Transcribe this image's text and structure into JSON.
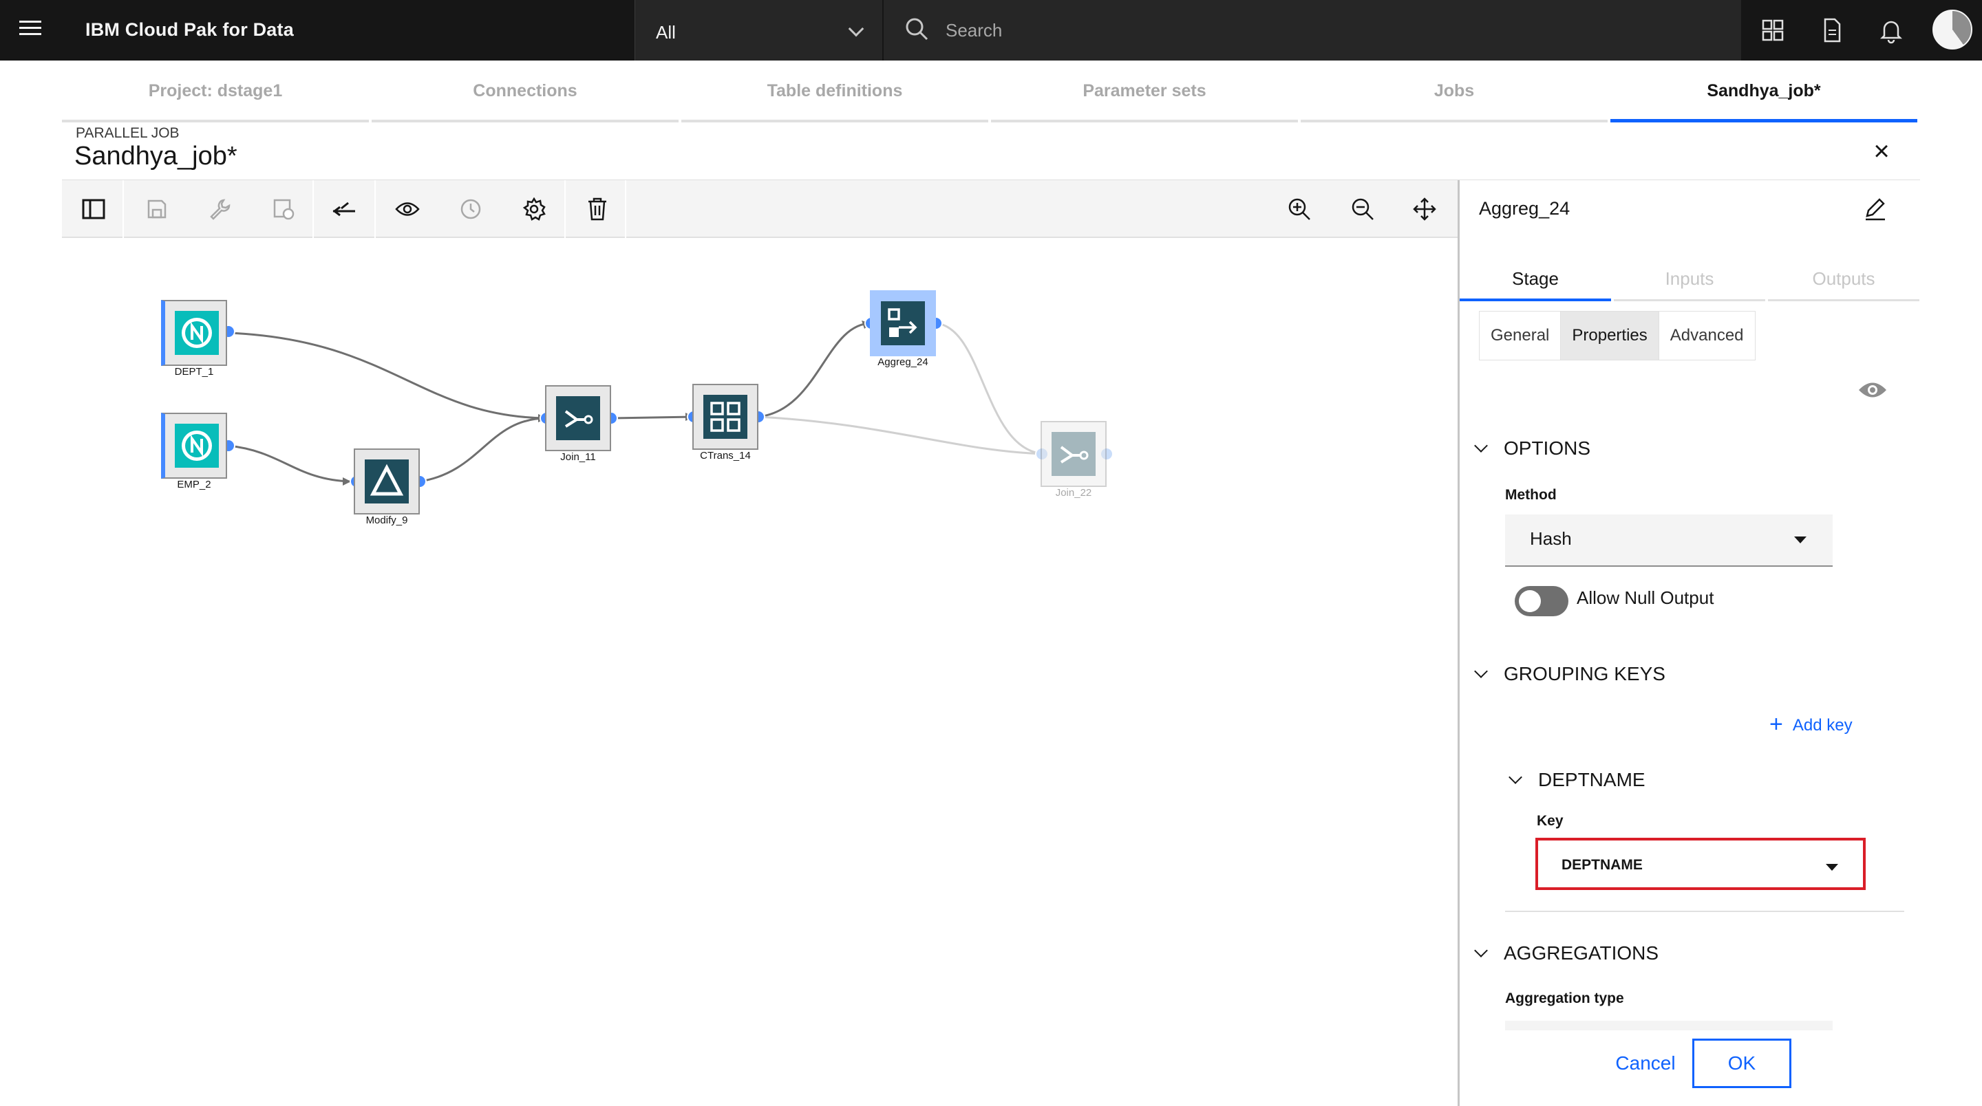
{
  "header": {
    "brand": "IBM Cloud Pak for Data",
    "scope_value": "All",
    "search_placeholder": "Search"
  },
  "project_tabs": [
    {
      "label": "Project: dstage1"
    },
    {
      "label": "Connections"
    },
    {
      "label": "Table definitions"
    },
    {
      "label": "Parameter sets"
    },
    {
      "label": "Jobs"
    },
    {
      "label": "Sandhya_job*"
    }
  ],
  "job": {
    "kind": "PARALLEL JOB",
    "name": "Sandhya_job*"
  },
  "canvas": {
    "nodes": [
      {
        "label": "DEPT_1",
        "type": "source",
        "icon": "n-connector-icon"
      },
      {
        "label": "EMP_2",
        "type": "source",
        "icon": "n-connector-icon"
      },
      {
        "label": "Modify_9",
        "type": "modify",
        "icon": "triangle-icon"
      },
      {
        "label": "Join_11",
        "type": "join",
        "icon": "join-icon"
      },
      {
        "label": "CTrans_14",
        "type": "transformer",
        "icon": "grid-transform-icon"
      },
      {
        "label": "Aggreg_24",
        "type": "aggregator",
        "icon": "aggregator-icon",
        "selected": true
      },
      {
        "label": "Join_22",
        "type": "join",
        "icon": "join-icon",
        "disabled": true
      }
    ]
  },
  "panel": {
    "title": "Aggreg_24",
    "stage_tabs": [
      "Stage",
      "Inputs",
      "Outputs"
    ],
    "content_tabs": [
      "General",
      "Properties",
      "Advanced"
    ],
    "sections": {
      "options": "OPTIONS",
      "grouping_keys": "GROUPING KEYS",
      "deptname": "DEPTNAME",
      "aggregations": "AGGREGATIONS"
    },
    "method_label": "Method",
    "method_value": "Hash",
    "allow_null_label": "Allow Null Output",
    "allow_null_on": false,
    "add_key_label": "Add key",
    "key_label": "Key",
    "key_value": "DEPTNAME",
    "aggregation_type_label": "Aggregation type",
    "cancel_label": "Cancel",
    "ok_label": "OK"
  },
  "colors": {
    "accent": "#0f62fe",
    "highlight": "#da1e28",
    "connector_green": "#08bdba",
    "node_dark": "#1f4d5c"
  }
}
